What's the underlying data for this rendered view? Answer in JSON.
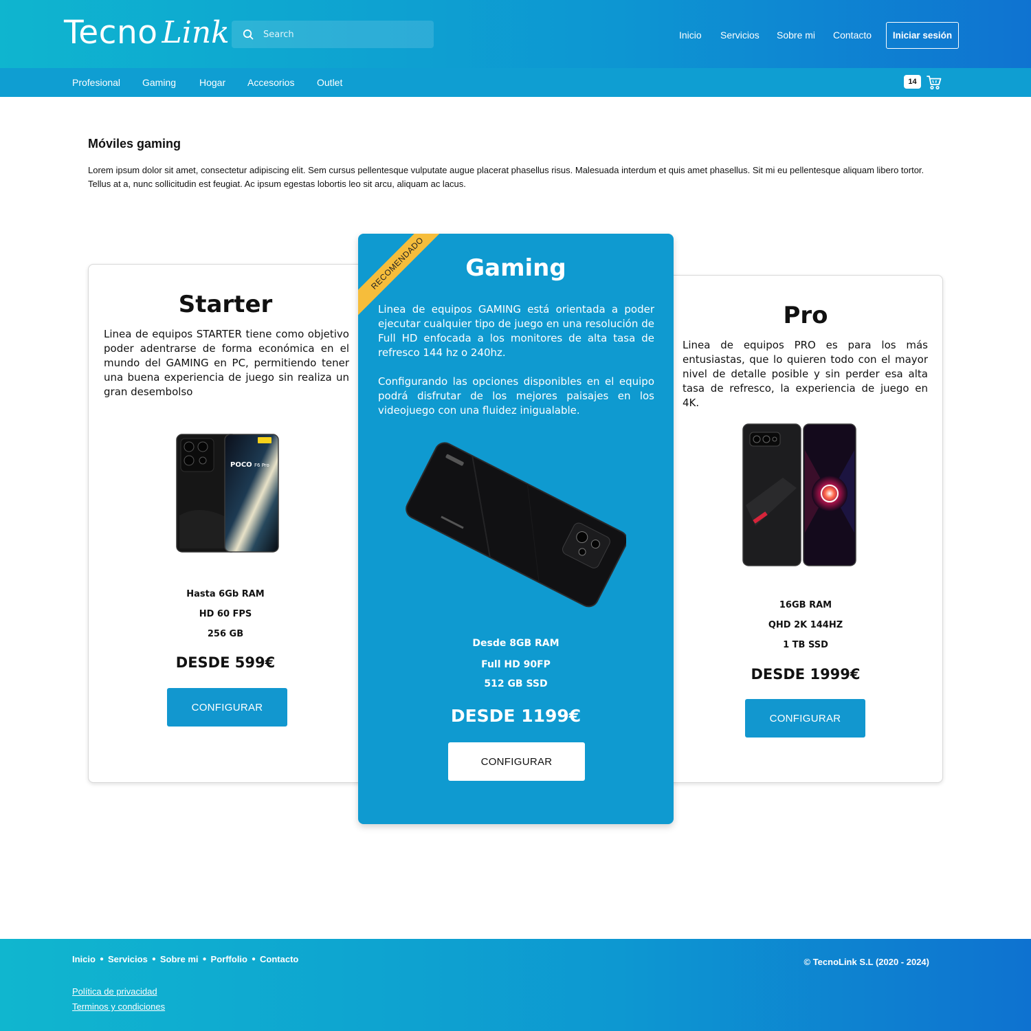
{
  "brand": {
    "logo_main": "Tecno",
    "logo_script": "Link"
  },
  "search": {
    "placeholder": "Search",
    "value": ""
  },
  "top_nav": {
    "items": [
      "Inicio",
      "Servicios",
      "Sobre mi",
      "Contacto"
    ],
    "login_label": "Iniciar sesión"
  },
  "sub_nav": {
    "items": [
      "Profesional",
      "Gaming",
      "Hogar",
      "Accesorios",
      "Outlet"
    ]
  },
  "cart": {
    "count": "14",
    "icon": "cart-icon"
  },
  "intro": {
    "title": "Móviles gaming",
    "text": "Lorem ipsum dolor sit amet, consectetur adipiscing elit. Sem cursus pellentesque vulputate augue placerat phasellus risus. Malesuada interdum et quis amet phasellus. Sit mi eu pellentesque aliquam libero tortor. Tellus at a, nunc sollicitudin est feugiat. Ac ipsum egestas lobortis leo sit arcu, aliquam ac lacus."
  },
  "plans": {
    "starter": {
      "title": "Starter",
      "description": "Linea de equipos STARTER tiene como objetivo poder adentrarse de forma económica en el mundo del GAMING en PC, permitiendo tener una buena experiencia de juego sin realiza un gran desembolso",
      "phone_brand": "POCO",
      "phone_model": "F6 Pro",
      "specs": [
        "Hasta 6Gb RAM",
        "HD 60 FPS",
        "256 GB"
      ],
      "price": "DESDE 599€",
      "button": "CONFIGURAR"
    },
    "gaming": {
      "ribbon": "RECOMENDADO",
      "title": "Gaming",
      "description_1": "Linea de equipos GAMING está orientada a poder ejecutar cualquier tipo de juego en una resolución de Full HD enfocada a los monitores de alta tasa de refresco 144 hz o 240hz.",
      "description_2": "Configurando las opciones disponibles en el equipo podrá disfrutar de los mejores paisajes en los videojuego con una fluidez inigualable.",
      "specs": [
        "Desde 8GB RAM",
        "Full HD 90FP",
        "512 GB SSD"
      ],
      "price": "DESDE 1199€",
      "button": "CONFIGURAR"
    },
    "pro": {
      "title": "Pro",
      "description": "Linea de equipos PRO es para los más entusiastas, que lo quieren todo con el mayor nivel de detalle posible y sin perder esa alta tasa de refresco, la experiencia de juego en 4K.",
      "specs": [
        "16GB RAM",
        "QHD 2K 144HZ",
        "1 TB SSD"
      ],
      "price": "DESDE 1999€",
      "button": "CONFIGURAR"
    }
  },
  "footer": {
    "links": [
      "Inicio",
      "Servicios",
      "Sobre mi",
      "Porffolio",
      "Contacto"
    ],
    "copyright": "© TecnoLink S.L (2020 - 2024)",
    "privacy": "Política de privacidad",
    "terms": "Terminos y condiciones"
  },
  "colors": {
    "header_gradient_start": "#0fb5cf",
    "header_gradient_end": "#0f73d1",
    "subbar": "#0f9ed2",
    "accent": "#1297cf",
    "ribbon": "#f6bd3b"
  }
}
